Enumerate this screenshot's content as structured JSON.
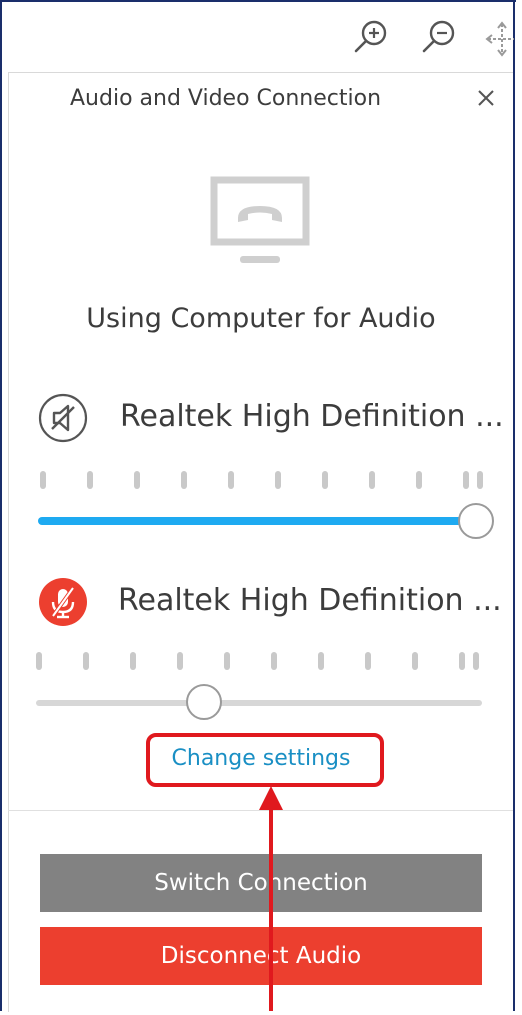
{
  "dialog": {
    "title": "Audio and Video Connection",
    "status_text": "Using Computer for Audio",
    "change_settings_label": "Change settings"
  },
  "toolbar": {
    "icons": [
      "zoom-in-icon",
      "zoom-out-icon",
      "move-icon"
    ]
  },
  "devices": {
    "speaker": {
      "label": "Realtek High Definition ...",
      "muted": true,
      "volume": 1.0
    },
    "microphone": {
      "label": "Realtek High Definition ...",
      "muted": true,
      "volume": 0.38
    }
  },
  "buttons": {
    "switch_connection": "Switch Connection",
    "disconnect_audio": "Disconnect Audio"
  },
  "colors": {
    "accent_blue": "#1eaaf1",
    "link_blue": "#1a8fc4",
    "danger_red": "#ec3f2f",
    "annotation_red": "#e0191e",
    "button_gray": "#828282"
  }
}
